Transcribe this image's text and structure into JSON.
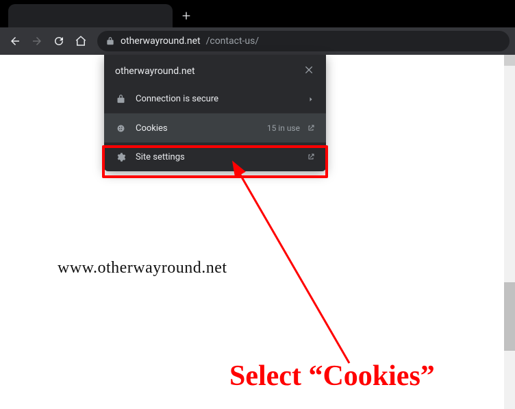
{
  "toolbar": {
    "url_domain": "otherwayround.net",
    "url_path": "/contact-us/"
  },
  "popover": {
    "title": "otherwayround.net",
    "rows": {
      "secure": {
        "label": "Connection is secure"
      },
      "cookies": {
        "label": "Cookies",
        "trail": "15 in use"
      },
      "settings": {
        "label": "Site settings"
      }
    }
  },
  "watermark": "www.otherwayround.net",
  "annotation": "Select “Cookies”"
}
